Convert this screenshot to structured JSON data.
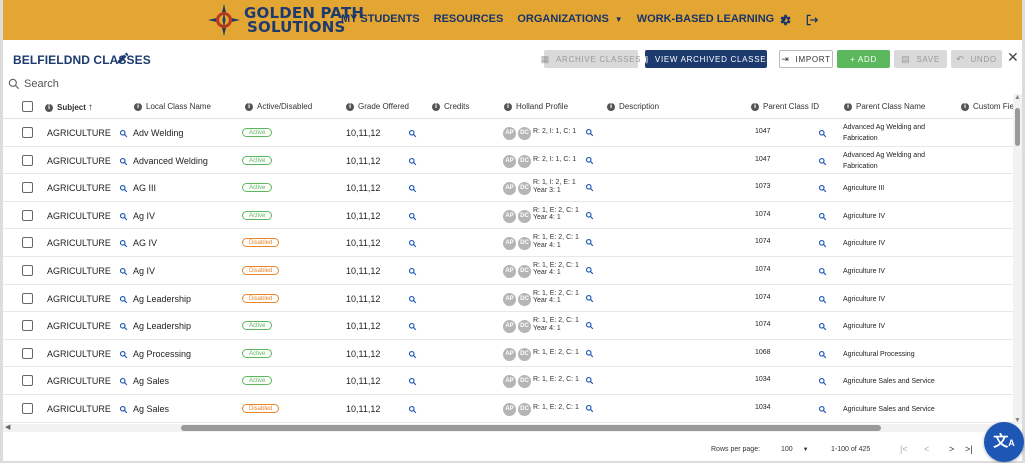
{
  "header": {
    "logo_line1": "GOLDEN PATH",
    "logo_line2": "SOLUTIONS",
    "nav": [
      {
        "label": "MY STUDENTS",
        "dropdown": false
      },
      {
        "label": "RESOURCES",
        "dropdown": false
      },
      {
        "label": "ORGANIZATIONS",
        "dropdown": true
      },
      {
        "label": "WORK-BASED LEARNING",
        "dropdown": true
      }
    ],
    "settings_icon": "gear-icon",
    "logout_icon": "logout-icon"
  },
  "toolbar": {
    "title": "BELFIELDND CLASSES",
    "archive_label": "ARCHIVE CLASSES",
    "view_archived_label": "VIEW ARCHIVED CLASSES",
    "import_label": "IMPORT",
    "add_label": "+ ADD",
    "save_label": "SAVE",
    "undo_label": "UNDO"
  },
  "search": {
    "placeholder": "Search"
  },
  "table": {
    "columns": [
      "Subject",
      "Local Class Name",
      "Active/Disabled",
      "Grade Offered",
      "Credits",
      "Holland Profile",
      "Description",
      "Parent Class ID",
      "Parent Class Name",
      "Custom Field"
    ],
    "sort_column": "Subject",
    "sort_direction": "ascending",
    "pill_labels": [
      "AP",
      "DC"
    ],
    "rows": [
      {
        "subject": "AGRICULTURE",
        "local": "Adv Welding",
        "status": "Active",
        "grade": "10,11,12",
        "holland1": "R: 2, I: 1, C: 1",
        "holland2": "",
        "pid": "1047",
        "pname1": "Advanced Ag Welding and",
        "pname2": "Fabrication"
      },
      {
        "subject": "AGRICULTURE",
        "local": "Advanced Welding",
        "status": "Active",
        "grade": "10,11,12",
        "holland1": "R: 2, I: 1, C: 1",
        "holland2": "",
        "pid": "1047",
        "pname1": "Advanced Ag Welding and",
        "pname2": "Fabrication"
      },
      {
        "subject": "AGRICULTURE",
        "local": "AG III",
        "status": "Active",
        "grade": "10,11,12",
        "holland1": "R: 1, I: 2, E: 1",
        "holland2": "Year 3: 1",
        "pid": "1073",
        "pname1": "Agriculture III",
        "pname2": ""
      },
      {
        "subject": "AGRICULTURE",
        "local": "Ag IV",
        "status": "Active",
        "grade": "10,11,12",
        "holland1": "R: 1, E: 2, C: 1",
        "holland2": "Year 4: 1",
        "pid": "1074",
        "pname1": "Agriculture IV",
        "pname2": ""
      },
      {
        "subject": "AGRICULTURE",
        "local": "AG IV",
        "status": "Disabled",
        "grade": "10,11,12",
        "holland1": "R: 1, E: 2, C: 1",
        "holland2": "Year 4: 1",
        "pid": "1074",
        "pname1": "Agriculture IV",
        "pname2": ""
      },
      {
        "subject": "AGRICULTURE",
        "local": "Ag IV",
        "status": "Disabled",
        "grade": "10,11,12",
        "holland1": "R: 1, E: 2, C: 1",
        "holland2": "Year 4: 1",
        "pid": "1074",
        "pname1": "Agriculture IV",
        "pname2": ""
      },
      {
        "subject": "AGRICULTURE",
        "local": "Ag Leadership",
        "status": "Disabled",
        "grade": "10,11,12",
        "holland1": "R: 1, E: 2, C: 1",
        "holland2": "Year 4: 1",
        "pid": "1074",
        "pname1": "Agriculture IV",
        "pname2": ""
      },
      {
        "subject": "AGRICULTURE",
        "local": "Ag Leadership",
        "status": "Active",
        "grade": "10,11,12",
        "holland1": "R: 1, E: 2, C: 1",
        "holland2": "Year 4: 1",
        "pid": "1074",
        "pname1": "Agriculture IV",
        "pname2": ""
      },
      {
        "subject": "AGRICULTURE",
        "local": "Ag Processing",
        "status": "Active",
        "grade": "10,11,12",
        "holland1": "R: 1, E: 2, C: 1",
        "holland2": "",
        "pid": "1068",
        "pname1": "Agricultural Processing",
        "pname2": ""
      },
      {
        "subject": "AGRICULTURE",
        "local": "Ag Sales",
        "status": "Active",
        "grade": "10,11,12",
        "holland1": "R: 1, E: 2, C: 1",
        "holland2": "",
        "pid": "1034",
        "pname1": "Agriculture Sales and Service",
        "pname2": ""
      },
      {
        "subject": "AGRICULTURE",
        "local": "Ag Sales",
        "status": "Disabled",
        "grade": "10,11,12",
        "holland1": "R: 1, E: 2, C: 1",
        "holland2": "",
        "pid": "1034",
        "pname1": "Agriculture Sales and Service",
        "pname2": ""
      }
    ]
  },
  "footer": {
    "rows_per_page_label": "Rows per page:",
    "rows_per_page_value": "100",
    "range_text": "1-100 of 425"
  },
  "colors": {
    "brand_gold": "#e4a632",
    "brand_navy": "#1d3a6e",
    "active_green": "#5cb85c",
    "disabled_orange": "#e8862e",
    "fab_blue": "#1d56b5"
  }
}
